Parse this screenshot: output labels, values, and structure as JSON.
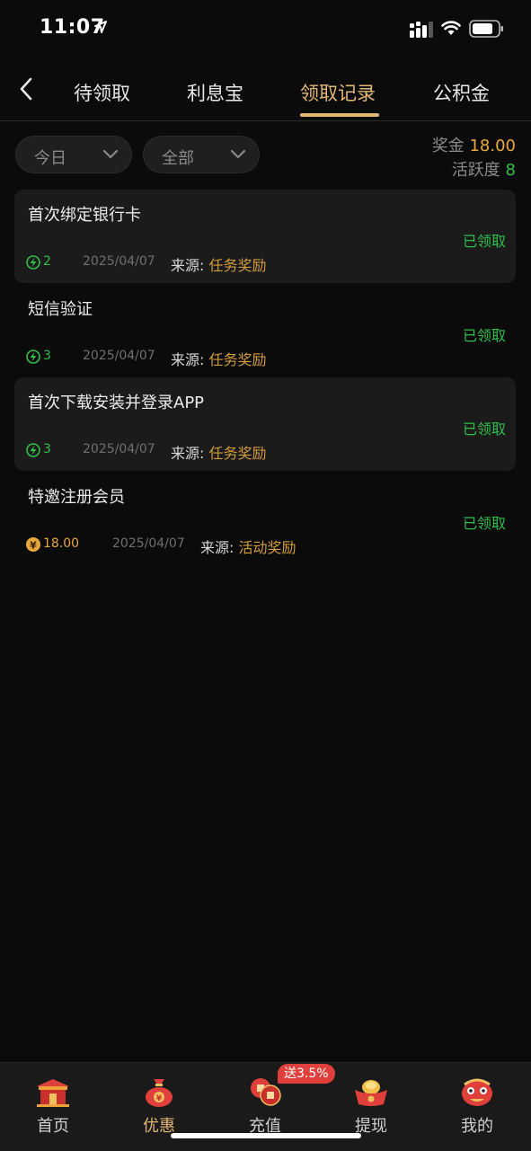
{
  "status_bar": {
    "time": "11:07"
  },
  "tabs": [
    {
      "label": "待领取"
    },
    {
      "label": "利息宝"
    },
    {
      "label": "领取记录"
    },
    {
      "label": "公积金"
    }
  ],
  "filters": {
    "date": "今日",
    "type": "全部"
  },
  "summary": {
    "bonus_label": "奖金",
    "bonus_value": "18.00",
    "activity_label": "活跃度",
    "activity_value": "8"
  },
  "records": [
    {
      "title": "首次绑定银行卡",
      "status": "已领取",
      "reward_icon": "lightning-icon",
      "reward": "2",
      "date": "2025/04/07",
      "source_label": "来源:",
      "source": "任务奖励"
    },
    {
      "title": "短信验证",
      "status": "已领取",
      "reward_icon": "lightning-icon",
      "reward": "3",
      "date": "2025/04/07",
      "source_label": "来源:",
      "source": "任务奖励"
    },
    {
      "title": "首次下载安装并登录APP",
      "status": "已领取",
      "reward_icon": "lightning-icon",
      "reward": "3",
      "date": "2025/04/07",
      "source_label": "来源:",
      "source": "任务奖励"
    },
    {
      "title": "特邀注册会员",
      "status": "已领取",
      "reward_icon": "yuan-coin-icon",
      "reward": "18.00",
      "date": "2025/04/07",
      "source_label": "来源:",
      "source": "活动奖励"
    }
  ],
  "bottom_nav": {
    "items": [
      {
        "label": "首页",
        "icon": "temple-icon"
      },
      {
        "label": "优惠",
        "icon": "money-bag-icon"
      },
      {
        "label": "充值",
        "icon": "coins-icon"
      },
      {
        "label": "提现",
        "icon": "gold-ingot-icon"
      },
      {
        "label": "我的",
        "icon": "lion-head-icon"
      }
    ],
    "recharge_badge": "送3.5%"
  },
  "colors": {
    "accent": "#e2b773",
    "gold": "#e8a93a",
    "green": "#2fbf4a",
    "badge": "#e0403b",
    "background": "#0b0b0b"
  }
}
